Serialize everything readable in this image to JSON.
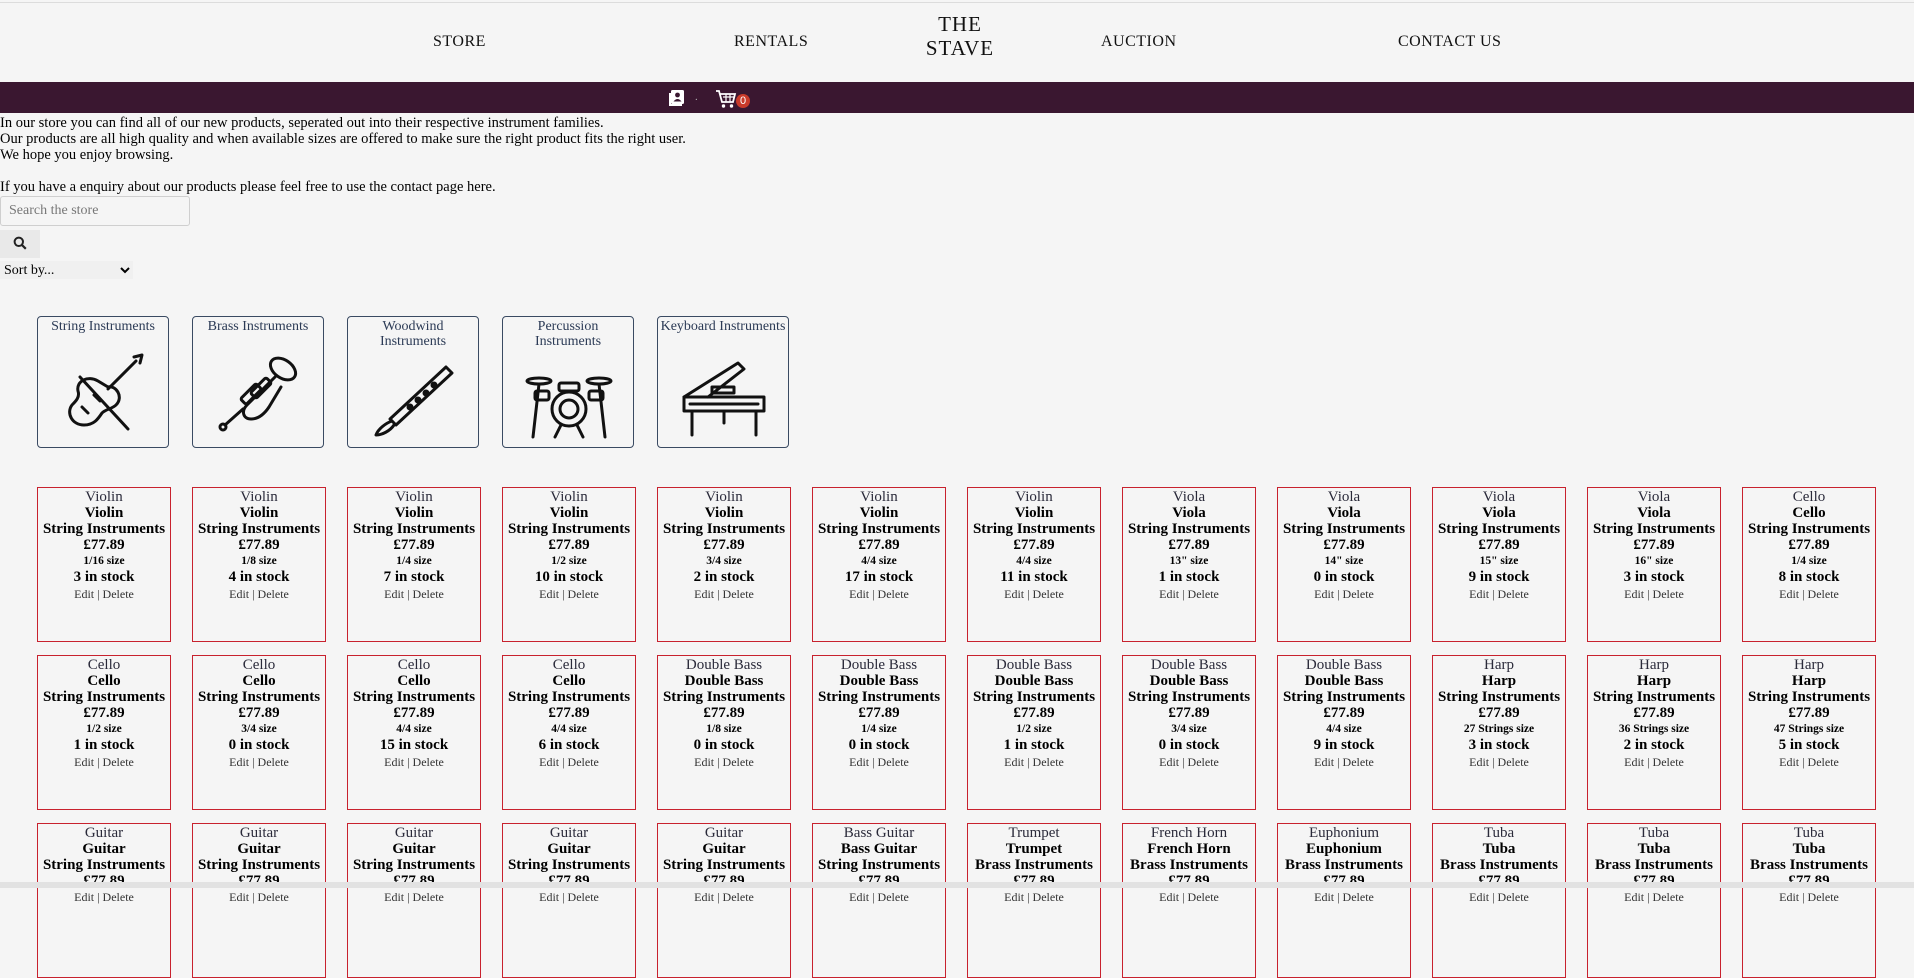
{
  "nav": {
    "store": "STORE",
    "rentals": "RENTALS",
    "logo_line1": "THE",
    "logo_line2": "STAVE",
    "auction": "AUCTION",
    "contact": "CONTACT US"
  },
  "userbar": {
    "separator": ".",
    "cart_count": "0",
    "bar_color": "#3a1730",
    "badge_color": "#c83a2a"
  },
  "intro": {
    "line1": "In our store you can find all of our new products, seperated out into their respective instrument families.",
    "line2": "Our products are all high quality and when available sizes are offered to make sure the right product fits the right user.",
    "line3": "We hope you enjoy browsing.",
    "line4": "If you have a enquiry about our products please feel free to use the contact page here."
  },
  "search": {
    "placeholder": "Search the store"
  },
  "sort": {
    "selected": "Sort by..."
  },
  "categories": [
    {
      "label": "String Instruments",
      "icon": "violin-icon"
    },
    {
      "label": "Brass Instruments",
      "icon": "tuba-icon"
    },
    {
      "label": "Woodwind Instruments",
      "icon": "clarinet-icon"
    },
    {
      "label": "Percussion Instruments",
      "icon": "drum-kit-icon"
    },
    {
      "label": "Keyboard Instruments",
      "icon": "piano-icon"
    }
  ],
  "product_actions": {
    "edit": "Edit",
    "sep": "|",
    "delete": "Delete"
  },
  "products": [
    {
      "name": "Violin",
      "family": "String Instruments",
      "price": "£77.89",
      "size": "1/16 size",
      "stock": "3 in stock"
    },
    {
      "name": "Violin",
      "family": "String Instruments",
      "price": "£77.89",
      "size": "1/8 size",
      "stock": "4 in stock"
    },
    {
      "name": "Violin",
      "family": "String Instruments",
      "price": "£77.89",
      "size": "1/4 size",
      "stock": "7 in stock"
    },
    {
      "name": "Violin",
      "family": "String Instruments",
      "price": "£77.89",
      "size": "1/2 size",
      "stock": "10 in stock"
    },
    {
      "name": "Violin",
      "family": "String Instruments",
      "price": "£77.89",
      "size": "3/4 size",
      "stock": "2 in stock"
    },
    {
      "name": "Violin",
      "family": "String Instruments",
      "price": "£77.89",
      "size": "4/4 size",
      "stock": "17 in stock"
    },
    {
      "name": "Violin",
      "family": "String Instruments",
      "price": "£77.89",
      "size": "4/4 size",
      "stock": "11 in stock"
    },
    {
      "name": "Viola",
      "family": "String Instruments",
      "price": "£77.89",
      "size": "13\" size",
      "stock": "1 in stock"
    },
    {
      "name": "Viola",
      "family": "String Instruments",
      "price": "£77.89",
      "size": "14\" size",
      "stock": "0 in stock"
    },
    {
      "name": "Viola",
      "family": "String Instruments",
      "price": "£77.89",
      "size": "15\" size",
      "stock": "9 in stock"
    },
    {
      "name": "Viola",
      "family": "String Instruments",
      "price": "£77.89",
      "size": "16\" size",
      "stock": "3 in stock"
    },
    {
      "name": "Cello",
      "family": "String Instruments",
      "price": "£77.89",
      "size": "1/4 size",
      "stock": "8 in stock"
    },
    {
      "name": "Cello",
      "family": "String Instruments",
      "price": "£77.89",
      "size": "1/2 size",
      "stock": "1 in stock"
    },
    {
      "name": "Cello",
      "family": "String Instruments",
      "price": "£77.89",
      "size": "3/4 size",
      "stock": "0 in stock"
    },
    {
      "name": "Cello",
      "family": "String Instruments",
      "price": "£77.89",
      "size": "4/4 size",
      "stock": "15 in stock"
    },
    {
      "name": "Cello",
      "family": "String Instruments",
      "price": "£77.89",
      "size": "4/4 size",
      "stock": "6 in stock"
    },
    {
      "name": "Double Bass",
      "family": "String Instruments",
      "price": "£77.89",
      "size": "1/8 size",
      "stock": "0 in stock"
    },
    {
      "name": "Double Bass",
      "family": "String Instruments",
      "price": "£77.89",
      "size": "1/4 size",
      "stock": "0 in stock"
    },
    {
      "name": "Double Bass",
      "family": "String Instruments",
      "price": "£77.89",
      "size": "1/2 size",
      "stock": "1 in stock"
    },
    {
      "name": "Double Bass",
      "family": "String Instruments",
      "price": "£77.89",
      "size": "3/4 size",
      "stock": "0 in stock"
    },
    {
      "name": "Double Bass",
      "family": "String Instruments",
      "price": "£77.89",
      "size": "4/4 size",
      "stock": "9 in stock"
    },
    {
      "name": "Harp",
      "family": "String Instruments",
      "price": "£77.89",
      "size": "27 Strings size",
      "stock": "3 in stock"
    },
    {
      "name": "Harp",
      "family": "String Instruments",
      "price": "£77.89",
      "size": "36 Strings size",
      "stock": "2 in stock"
    },
    {
      "name": "Harp",
      "family": "String Instruments",
      "price": "£77.89",
      "size": "47 Strings size",
      "stock": "5 in stock"
    },
    {
      "name": "Guitar",
      "family": "String Instruments",
      "price": "£77.89",
      "size": "",
      "stock": ""
    },
    {
      "name": "Guitar",
      "family": "String Instruments",
      "price": "£77.89",
      "size": "",
      "stock": ""
    },
    {
      "name": "Guitar",
      "family": "String Instruments",
      "price": "£77.89",
      "size": "",
      "stock": ""
    },
    {
      "name": "Guitar",
      "family": "String Instruments",
      "price": "£77.89",
      "size": "",
      "stock": ""
    },
    {
      "name": "Guitar",
      "family": "String Instruments",
      "price": "£77.89",
      "size": "",
      "stock": ""
    },
    {
      "name": "Bass Guitar",
      "family": "String Instruments",
      "price": "£77.89",
      "size": "",
      "stock": ""
    },
    {
      "name": "Trumpet",
      "family": "Brass Instruments",
      "price": "£77.89",
      "size": "",
      "stock": ""
    },
    {
      "name": "French Horn",
      "family": "Brass Instruments",
      "price": "£77.89",
      "size": "",
      "stock": ""
    },
    {
      "name": "Euphonium",
      "family": "Brass Instruments",
      "price": "£77.89",
      "size": "",
      "stock": ""
    },
    {
      "name": "Tuba",
      "family": "Brass Instruments",
      "price": "£77.89",
      "size": "",
      "stock": ""
    },
    {
      "name": "Tuba",
      "family": "Brass Instruments",
      "price": "£77.89",
      "size": "",
      "stock": ""
    },
    {
      "name": "Tuba",
      "family": "Brass Instruments",
      "price": "£77.89",
      "size": "",
      "stock": ""
    }
  ]
}
